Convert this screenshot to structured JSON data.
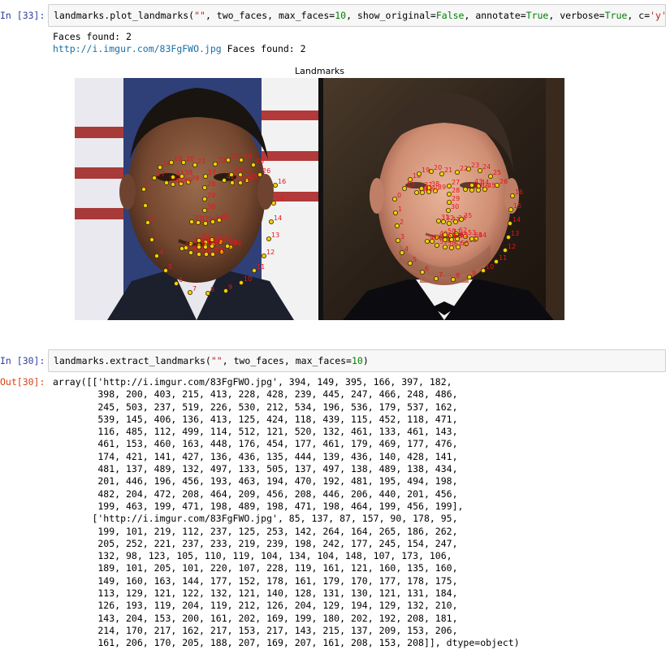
{
  "cell33": {
    "prompt": "In [33]:",
    "code_parts": [
      "landmarks.plot_landmarks(",
      "\"\"",
      ", two_faces, max_faces=",
      "10",
      ", show_original=",
      "False",
      ", annotate=",
      "True",
      ", verbose=",
      "True",
      ", c=",
      "'y'"
    ],
    "output_lines": [
      "Faces found: 2"
    ],
    "output_link": "http://i.imgur.com/83FgFWO.jpg",
    "output_link_suffix": " Faces found: 2",
    "figure_title": "Landmarks"
  },
  "cell30": {
    "prompt": "In [30]:",
    "out_prompt": "Out[30]:",
    "code_parts": [
      "landmarks.extract_landmarks(",
      "\"\"",
      ", two_faces, max_faces=",
      "10",
      ")"
    ],
    "output_text": "array([['http://i.imgur.com/83FgFWO.jpg', 394, 149, 395, 166, 397, 182,\n        398, 200, 403, 215, 413, 228, 428, 239, 445, 247, 466, 248, 486,\n        245, 503, 237, 519, 226, 530, 212, 534, 196, 536, 179, 537, 162,\n        539, 145, 406, 136, 413, 125, 424, 118, 439, 115, 452, 118, 471,\n        116, 485, 112, 499, 114, 512, 121, 520, 132, 461, 133, 461, 143,\n        461, 153, 460, 163, 448, 176, 454, 177, 461, 179, 469, 177, 476,\n        174, 421, 141, 427, 136, 436, 135, 444, 139, 436, 140, 428, 141,\n        481, 137, 489, 132, 497, 133, 505, 137, 497, 138, 489, 138, 434,\n        201, 446, 196, 456, 193, 463, 194, 470, 192, 481, 195, 494, 198,\n        482, 204, 472, 208, 464, 209, 456, 208, 446, 206, 440, 201, 456,\n        199, 463, 199, 471, 198, 489, 198, 471, 198, 464, 199, 456, 199],\n       ['http://i.imgur.com/83FgFWO.jpg', 85, 137, 87, 157, 90, 178, 95,\n        199, 101, 219, 112, 237, 125, 253, 142, 264, 164, 265, 186, 262,\n        205, 252, 221, 237, 233, 219, 239, 198, 242, 177, 245, 154, 247,\n        132, 98, 123, 105, 110, 119, 104, 134, 104, 148, 107, 173, 106,\n        189, 101, 205, 101, 220, 107, 228, 119, 161, 121, 160, 135, 160,\n        149, 160, 163, 144, 177, 152, 178, 161, 179, 170, 177, 178, 175,\n        113, 129, 121, 122, 132, 121, 140, 128, 131, 130, 121, 131, 184,\n        126, 193, 119, 204, 119, 212, 126, 204, 129, 194, 129, 132, 210,\n        143, 204, 153, 200, 161, 202, 169, 199, 180, 202, 192, 208, 181,\n        214, 170, 217, 162, 217, 153, 217, 143, 215, 137, 209, 153, 206,\n        161, 206, 170, 205, 188, 207, 169, 207, 161, 208, 153, 208]], dtype=object)"
  },
  "colors": {
    "prompt_in": "#303f9f",
    "prompt_out": "#d84315",
    "landmark_fill": "#f2d100",
    "landmark_label": "#e8141c"
  }
}
